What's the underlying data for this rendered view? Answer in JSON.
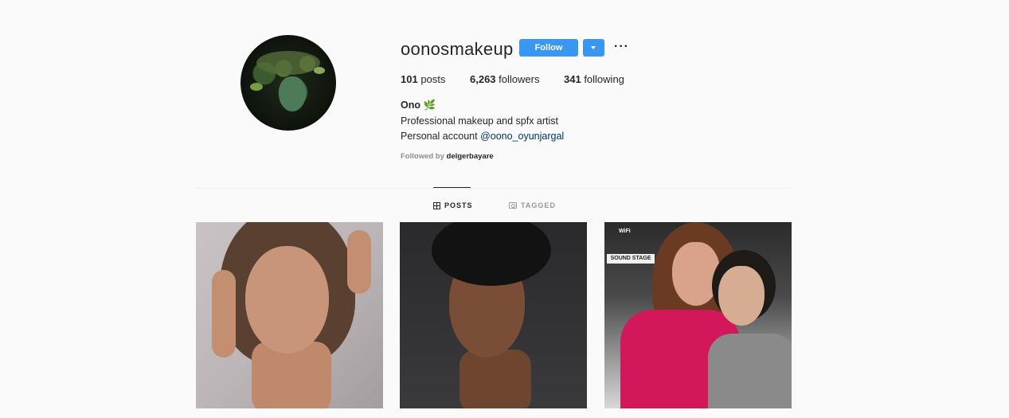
{
  "profile": {
    "username": "oonosmakeup",
    "follow_label": "Follow",
    "more_label": "···",
    "stats": {
      "posts_count": "101",
      "posts_label": " posts",
      "followers_count": "6,263",
      "followers_label": " followers",
      "following_count": "341",
      "following_label": " following"
    },
    "bio": {
      "name": "Ono 🌿",
      "line1": "Professional makeup and spfx artist",
      "line2_prefix": "Personal account ",
      "line2_link": "@oono_oyunjargal"
    },
    "followed_by_label": "Followed by ",
    "followed_by_user": "delgerbayare"
  },
  "tabs": [
    {
      "label": "POSTS",
      "active": true
    },
    {
      "label": "TAGGED",
      "active": false
    }
  ],
  "posts": [
    {
      "description": "portrait-1"
    },
    {
      "description": "portrait-2"
    },
    {
      "description": "portrait-3",
      "sign_text": "SOUND STAGE",
      "wifi_text": "WiFi"
    }
  ],
  "colors": {
    "accent": "#3897f0",
    "link": "#003569",
    "background": "#fafafa"
  }
}
